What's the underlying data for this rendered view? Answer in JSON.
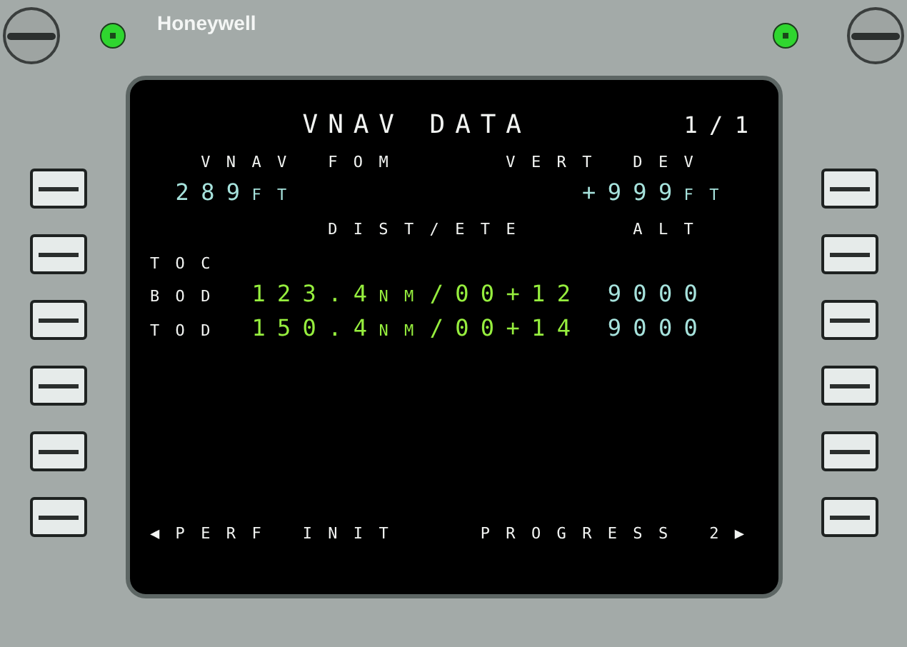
{
  "device": {
    "brand": "Honeywell",
    "annunciators": [
      {
        "on": true
      },
      {
        "on": true
      }
    ]
  },
  "screen": {
    "rows": [
      {
        "segments": [
          {
            "color": "#f2f4f2",
            "parts": [
              {
                "text": "VNAV DATA",
                "kind": "title"
              }
            ]
          },
          {
            "color": "#f2f4f2",
            "parts": [
              {
                "text": "1/1",
                "kind": "large"
              }
            ]
          }
        ]
      },
      {
        "segments": [
          {
            "color": "#f2f4f2",
            "parts": [
              {
                "text": "VNAV FOM",
                "kind": "small"
              }
            ]
          },
          {
            "color": "#f2f4f2",
            "parts": [
              {
                "text": "VERT DEV",
                "kind": "small"
              }
            ]
          }
        ]
      },
      {
        "segments": [
          {
            "color": "#a6e2dc",
            "parts": [
              {
                "text": "289",
                "kind": "large"
              },
              {
                "text": "FT",
                "kind": "small"
              }
            ]
          },
          {
            "color": "#a6e2dc",
            "parts": [
              {
                "text": "+999",
                "kind": "large"
              },
              {
                "text": "FT",
                "kind": "small"
              }
            ]
          }
        ]
      },
      {
        "segments": [
          {
            "color": "#f2f4f2",
            "parts": [
              {
                "text": "DIST/ETE",
                "kind": "small"
              }
            ]
          },
          {
            "color": "#f2f4f2",
            "parts": [
              {
                "text": "ALT",
                "kind": "small"
              }
            ]
          }
        ]
      },
      {
        "segments": [
          {
            "color": "#f2f4f2",
            "parts": [
              {
                "text": "TOC",
                "kind": "small"
              }
            ]
          }
        ]
      },
      {
        "segments": [
          {
            "color": "#f2f4f2",
            "parts": [
              {
                "text": "BOD",
                "kind": "small"
              }
            ]
          },
          {
            "color": "#96ee3e",
            "parts": [
              {
                "text": "123.4",
                "kind": "large"
              },
              {
                "text": "NM",
                "kind": "small"
              },
              {
                "text": "/00+12",
                "kind": "large"
              }
            ]
          },
          {
            "color": "#a6e2dc",
            "parts": [
              {
                "text": "9000",
                "kind": "large"
              }
            ]
          }
        ]
      },
      {
        "segments": [
          {
            "color": "#f2f4f2",
            "parts": [
              {
                "text": "TOD",
                "kind": "small"
              }
            ]
          },
          {
            "color": "#96ee3e",
            "parts": [
              {
                "text": "150.4",
                "kind": "large"
              },
              {
                "text": "NM",
                "kind": "small"
              },
              {
                "text": "/00+14",
                "kind": "large"
              }
            ]
          },
          {
            "color": "#a6e2dc",
            "parts": [
              {
                "text": "9000",
                "kind": "large"
              }
            ]
          }
        ]
      },
      {
        "segments": []
      },
      {
        "segments": []
      },
      {
        "segments": []
      },
      {
        "segments": []
      },
      {
        "segments": []
      },
      {
        "segments": [
          {
            "color": "#f2f4f2",
            "parts": [
              {
                "text": "◀PERF INIT",
                "kind": "small"
              }
            ]
          },
          {
            "color": "#f2f4f2",
            "parts": [
              {
                "text": "PROGRESS 2▶",
                "kind": "small"
              }
            ]
          }
        ]
      }
    ]
  }
}
